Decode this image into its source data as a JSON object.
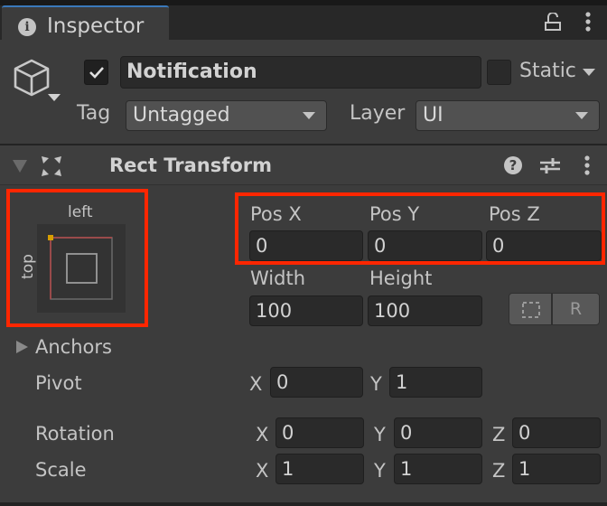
{
  "tab": {
    "label": "Inspector",
    "icon": "info-icon"
  },
  "tab_actions": {
    "lock": "lock-icon",
    "menu": "kebab-menu-icon"
  },
  "gameobject": {
    "active": true,
    "name": "Notification",
    "static_label": "Static",
    "static_checked": false,
    "tag_label": "Tag",
    "tag_value": "Untagged",
    "layer_label": "Layer",
    "layer_value": "UI"
  },
  "component": {
    "title": "Rect Transform",
    "expanded": true,
    "icons": [
      "rect-transform-icon",
      "help-icon",
      "preset-icon",
      "kebab-menu-icon"
    ]
  },
  "anchor_preset": {
    "horizontal": "left",
    "vertical": "top",
    "colors": {
      "anchor_dot": "#d69e00",
      "outer_left_top": "#b24848",
      "outer_rest": "#6a6a6a",
      "inner": "#9a9a9a"
    }
  },
  "highlight_color": "#ff2600",
  "position": {
    "labels": [
      "Pos X",
      "Pos Y",
      "Pos Z"
    ],
    "values": [
      "0",
      "0",
      "0"
    ]
  },
  "size": {
    "labels": [
      "Width",
      "Height"
    ],
    "values": [
      "100",
      "100"
    ]
  },
  "buttons": {
    "blueprint": "blueprint-mode-icon",
    "raw_label": "R"
  },
  "anchors": {
    "label": "Anchors",
    "expanded": false
  },
  "pivot": {
    "label": "Pivot",
    "x_label": "X",
    "x": "0",
    "y_label": "Y",
    "y": "1"
  },
  "rotation": {
    "label": "Rotation",
    "x_label": "X",
    "x": "0",
    "y_label": "Y",
    "y": "0",
    "z_label": "Z",
    "z": "0"
  },
  "scale": {
    "label": "Scale",
    "x_label": "X",
    "x": "1",
    "y_label": "Y",
    "y": "1",
    "z_label": "Z",
    "z": "1"
  }
}
